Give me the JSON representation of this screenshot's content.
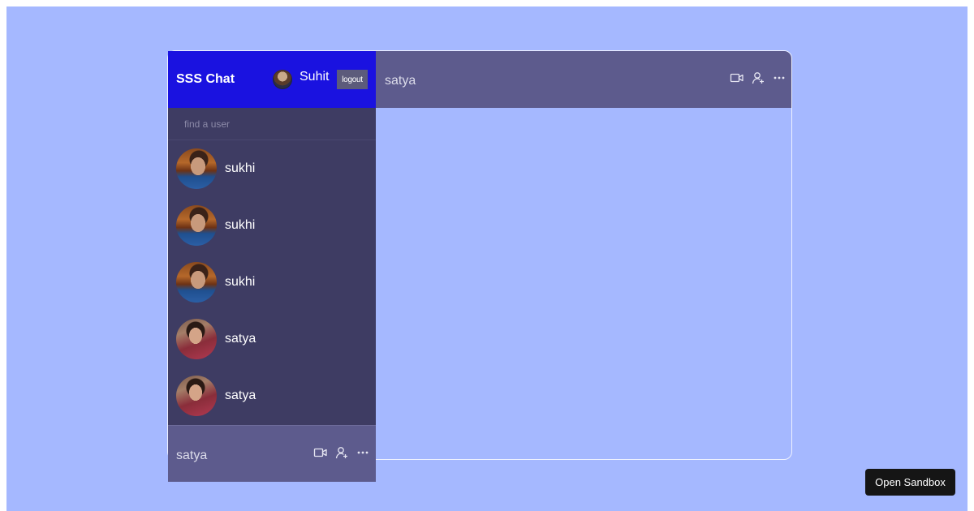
{
  "app": {
    "logo": "SSS Chat",
    "current_user": "Suhit",
    "logout_label": "logout"
  },
  "search": {
    "placeholder": "find a user",
    "value": ""
  },
  "chats": [
    {
      "name": "sukhi",
      "avatar": "sukhi-photo"
    },
    {
      "name": "sukhi",
      "avatar": "sukhi-photo"
    },
    {
      "name": "sukhi",
      "avatar": "sukhi-photo"
    },
    {
      "name": "satya",
      "avatar": "satya-photo"
    },
    {
      "name": "satya",
      "avatar": "satya-photo"
    }
  ],
  "chat_header": {
    "name": "satya",
    "icons": [
      "video-camera-icon",
      "add-user-icon",
      "more-icon"
    ]
  },
  "mini_header": {
    "name": "satya"
  },
  "sandbox": {
    "label": "Open Sandbox"
  },
  "colors": {
    "background": "#a5b8ff",
    "navbar": "#1a12e0",
    "sidebar": "#3e3c63",
    "header": "#5d5b8d"
  }
}
